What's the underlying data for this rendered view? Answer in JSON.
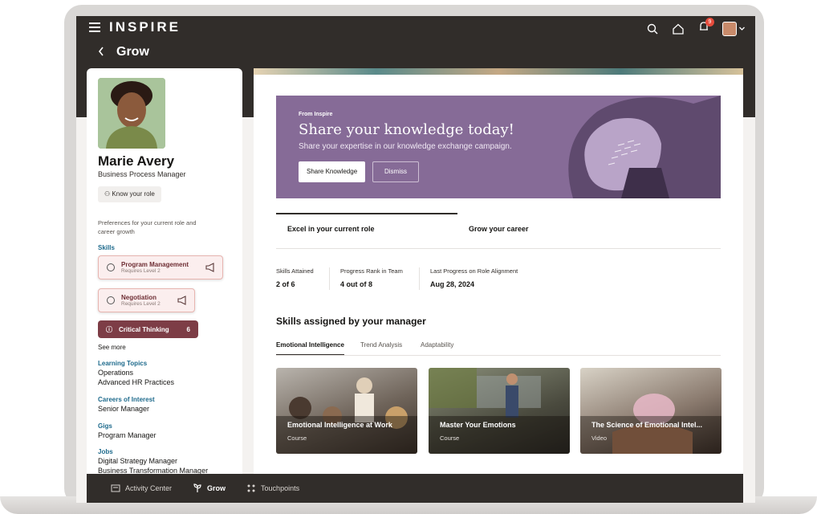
{
  "header": {
    "brand": "INSPIRE",
    "notification_count": "9",
    "back_icon": "chevron-left-icon",
    "page_title": "Grow"
  },
  "profile": {
    "name": "Marie Avery",
    "role": "Business Process Manager",
    "know_role_label": "Know your role",
    "preferences_text": "Preferences for your current role and career growth"
  },
  "skills": {
    "label": "Skills",
    "items": [
      {
        "title": "Program Management",
        "sub": "Requires Level 2"
      },
      {
        "title": "Negotiation",
        "sub": "Requires Level 2"
      }
    ],
    "highlight": {
      "title": "Critical Thinking",
      "count": "6"
    },
    "see_more": "See more"
  },
  "learning_topics": {
    "label": "Learning Topics",
    "items": [
      "Operations",
      "Advanced HR Practices"
    ]
  },
  "careers": {
    "label": "Careers of Interest",
    "items": [
      "Senior Manager"
    ]
  },
  "gigs": {
    "label": "Gigs",
    "items": [
      "Program Manager"
    ]
  },
  "jobs": {
    "label": "Jobs",
    "items": [
      "Digital Strategy Manager",
      "Business Transformation Manager"
    ]
  },
  "banner": {
    "small": "From Inspire",
    "title": "Share your knowledge today!",
    "subtitle": "Share your expertise in our knowledge exchange campaign.",
    "primary_btn": "Share Knowledge",
    "secondary_btn": "Dismiss",
    "color": "#866b97"
  },
  "tabs": [
    "Excel in your current role",
    "Grow your career"
  ],
  "stats": [
    {
      "label": "Skills Attained",
      "value": "2 of 6"
    },
    {
      "label": "Progress Rank in Team",
      "value": "4 out of 8"
    },
    {
      "label": "Last Progress on Role Alignment",
      "value": "Aug 28, 2024"
    }
  ],
  "assigned": {
    "title": "Skills assigned by your manager",
    "subtabs": [
      "Emotional Intelligence",
      "Trend Analysis",
      "Adaptability"
    ],
    "cards": [
      {
        "title": "Emotional Intelligence at Work",
        "type": "Course"
      },
      {
        "title": "Master Your Emotions",
        "type": "Course"
      },
      {
        "title": "The Science of Emotional Intel...",
        "type": "Video"
      }
    ]
  },
  "bottom_nav": [
    {
      "label": "Activity Center",
      "icon": "activity-icon"
    },
    {
      "label": "Grow",
      "icon": "grow-icon"
    },
    {
      "label": "Touchpoints",
      "icon": "touchpoints-icon"
    }
  ]
}
